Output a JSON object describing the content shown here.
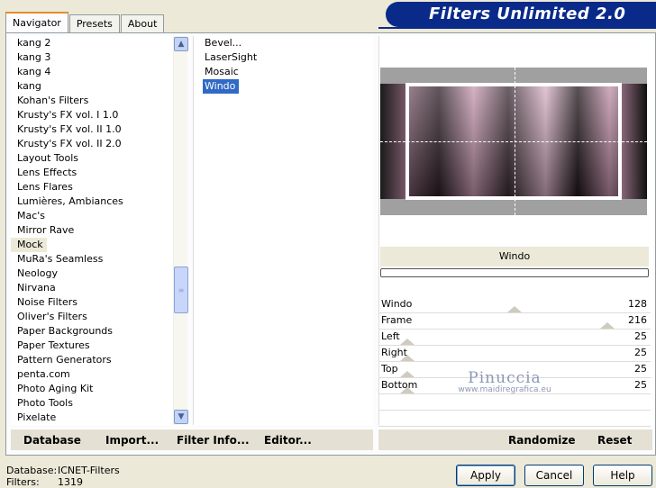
{
  "tabs": [
    "Navigator",
    "Presets",
    "About"
  ],
  "banner": "Filters Unlimited 2.0",
  "categories": [
    "kang 2",
    "kang 3",
    "kang 4",
    "kang",
    "Kohan's Filters",
    "Krusty's FX vol. I 1.0",
    "Krusty's FX vol. II 1.0",
    "Krusty's FX vol. II 2.0",
    "Layout Tools",
    "Lens Effects",
    "Lens Flares",
    "Lumières, Ambiances",
    "Mac's",
    "Mirror Rave",
    "Mock",
    "MuRa's Seamless",
    "Neology",
    "Nirvana",
    "Noise Filters",
    "Oliver's Filters",
    "Paper Backgrounds",
    "Paper Textures",
    "Pattern Generators",
    "penta.com",
    "Photo Aging Kit",
    "Photo Tools",
    "Pixelate"
  ],
  "selected_category": "Mock",
  "filters": [
    "Bevel...",
    "LaserSight",
    "Mosaic",
    "Windo"
  ],
  "selected_filter": "Windo",
  "filter_name": "Windo",
  "params": [
    {
      "label": "Windo",
      "value": "128"
    },
    {
      "label": "Frame",
      "value": "216"
    },
    {
      "label": "Left",
      "value": "25"
    },
    {
      "label": "Right",
      "value": "25"
    },
    {
      "label": "Top",
      "value": "25"
    },
    {
      "label": "Bottom",
      "value": "25"
    }
  ],
  "watermark": {
    "line1": "Pinuccia",
    "line2": "www.maidiregrafica.eu"
  },
  "toolbar_left": {
    "database": "Database",
    "import": "Import...",
    "filter_info": "Filter Info...",
    "editor": "Editor..."
  },
  "toolbar_right": {
    "randomize": "Randomize",
    "reset": "Reset"
  },
  "status": {
    "database_label": "Database:",
    "database_value": "ICNET-Filters",
    "filters_label": "Filters:",
    "filters_value": "1319"
  },
  "buttons": {
    "apply": "Apply",
    "cancel": "Cancel",
    "help": "Help"
  },
  "colors": {
    "banner": "#0a2a8a",
    "selection": "#316ac5",
    "tab_accent": "#e68b2c"
  }
}
